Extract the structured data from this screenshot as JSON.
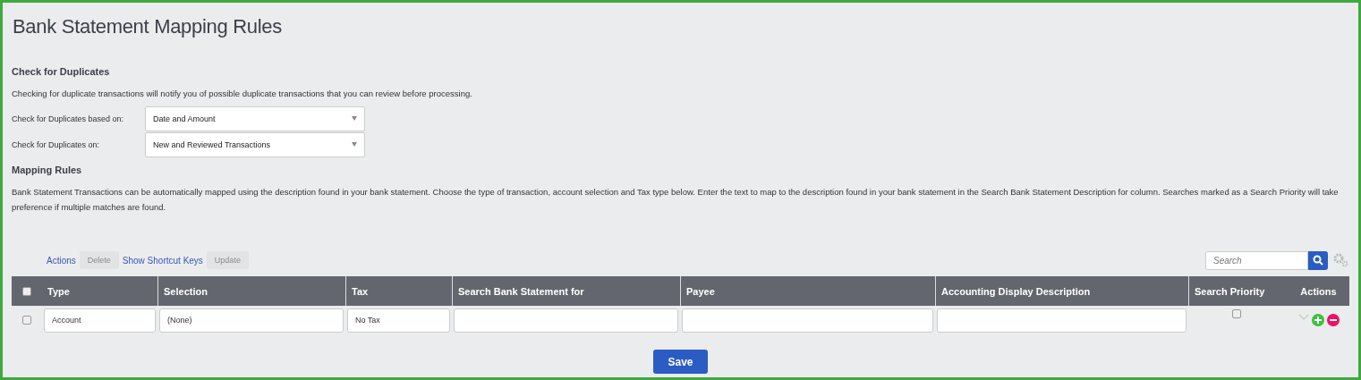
{
  "title": "Bank Statement Mapping Rules",
  "duplicates": {
    "heading": "Check for Duplicates",
    "description": "Checking for duplicate transactions will notify you of possible duplicate transactions that you can review before processing.",
    "fields": [
      {
        "label": "Check for Duplicates based on:",
        "value": "Date and Amount"
      },
      {
        "label": "Check for Duplicates on:",
        "value": "New and Reviewed Transactions"
      }
    ]
  },
  "mapping": {
    "heading": "Mapping Rules",
    "description": "Bank Statement Transactions can be automatically mapped using the description found in your bank statement. Choose the type of transaction, account selection and Tax type below. Enter the text to map to the description found in your bank statement in the Search Bank Statement Description for column. Searches marked as a Search Priority will take preference if multiple matches are found."
  },
  "toolbar": [
    {
      "kind": "link",
      "label": "Actions"
    },
    {
      "kind": "button",
      "label": "Delete",
      "disabled": true
    },
    {
      "kind": "link",
      "label": "Show Shortcut Keys"
    },
    {
      "kind": "button",
      "label": "Update",
      "disabled": true
    }
  ],
  "search": {
    "placeholder": "Search"
  },
  "table": {
    "select_all": {
      "checked": false
    },
    "columns": [
      "Type",
      "Selection",
      "Tax",
      "Search Bank Statement for",
      "Payee",
      "Accounting Display Description",
      "Search Priority",
      "Actions"
    ],
    "rows": [
      {
        "checked": false,
        "type": "Account",
        "selection": "(None)",
        "tax": "No Tax",
        "search_priority": false
      }
    ]
  },
  "save_button": "Save"
}
